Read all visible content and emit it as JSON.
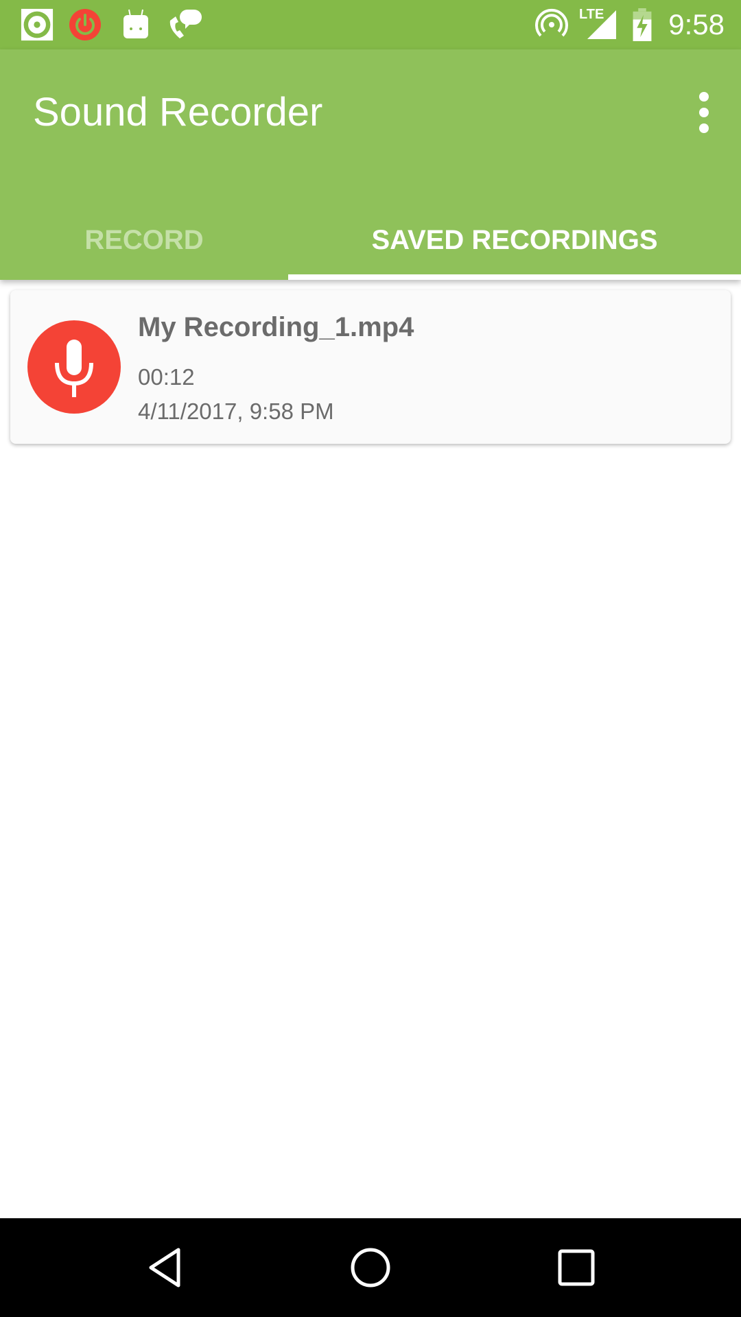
{
  "status_bar": {
    "notification_icons": [
      "record-indicator-icon",
      "power-icon",
      "android-icon",
      "voicemail-chat-icon"
    ],
    "system_icons": [
      "hotspot-icon",
      "lte-signal-icon",
      "battery-charging-icon"
    ],
    "network_label": "LTE",
    "time": "9:58"
  },
  "app_bar": {
    "title": "Sound Recorder",
    "overflow_icon": "more-vert-icon"
  },
  "tabs": [
    {
      "label": "RECORD",
      "selected": false
    },
    {
      "label": "SAVED RECORDINGS",
      "selected": true
    }
  ],
  "recordings": [
    {
      "icon": "microphone-icon",
      "name": "My Recording_1.mp4",
      "length": "00:12",
      "date": "4/11/2017, 9:58 PM"
    }
  ],
  "nav_bar": {
    "buttons": [
      "back-icon",
      "home-icon",
      "recents-icon"
    ]
  },
  "colors": {
    "status_bar": "#84ba48",
    "app_bar": "#8fc15a",
    "accent": "#f44336",
    "tab_inactive": "#c5e0a8"
  }
}
